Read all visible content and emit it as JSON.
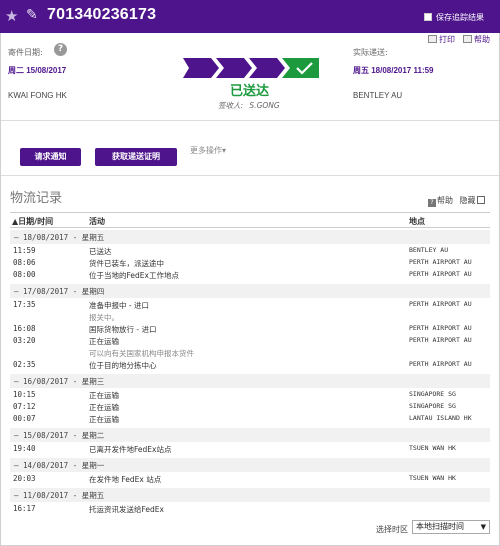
{
  "header": {
    "tracking_number": "701340236173",
    "save_results_label": "保存追踪结果"
  },
  "actions": {
    "print_label": "打印",
    "help_label": "帮助"
  },
  "shipment": {
    "ship_date_label": "寄件日期:",
    "ship_date": "周二 15/08/2017",
    "origin": "KWAI FONG HK",
    "delivered_label": "实际递送:",
    "delivered_date": "周五 18/08/2017 11:59",
    "destination": "BENTLEY AU",
    "status": "已送达",
    "signed_by_label": "签收人:",
    "signed_by": "S.GONG",
    "progress_steps": 4,
    "progress_completed": 4
  },
  "buttons": {
    "request_notify": "请求通知",
    "get_proof": "获取递送证明",
    "more_actions": "更多操作"
  },
  "history": {
    "title": "物流记录",
    "help": "帮助",
    "hide": "隐藏",
    "columns": {
      "datetime": "▲日期/时间",
      "activity": "活动",
      "location": "地点"
    },
    "groups": [
      {
        "date": "— 18/08/2017 - 星期五",
        "events": [
          {
            "time": "11:59",
            "activity": "已送达",
            "note": "",
            "location": "BENTLEY AU"
          },
          {
            "time": "08:06",
            "activity": "货件已装车，派送途中",
            "note": "",
            "location": "PERTH AIRPORT AU"
          },
          {
            "time": "08:00",
            "activity": "位于当地的FedEx工作地点",
            "note": "",
            "location": "PERTH AIRPORT AU"
          }
        ]
      },
      {
        "date": "— 17/08/2017 - 星期四",
        "events": [
          {
            "time": "17:35",
            "activity": "准备申报中 - 进口",
            "note": "报关中。",
            "location": "PERTH AIRPORT AU"
          },
          {
            "time": "16:08",
            "activity": "国际货物放行 - 进口",
            "note": "",
            "location": "PERTH AIRPORT AU"
          },
          {
            "time": "03:20",
            "activity": "正在运输",
            "note": "可以向有关国家机构申报本货件",
            "location": "PERTH AIRPORT AU"
          },
          {
            "time": "02:35",
            "activity": "位于目的地分拣中心",
            "note": "",
            "location": "PERTH AIRPORT AU"
          }
        ]
      },
      {
        "date": "— 16/08/2017 - 星期三",
        "events": [
          {
            "time": "10:15",
            "activity": "正在运输",
            "note": "",
            "location": "SINGAPORE SG"
          },
          {
            "time": "07:12",
            "activity": "正在运输",
            "note": "",
            "location": "SINGAPORE SG"
          },
          {
            "time": "00:07",
            "activity": "正在运输",
            "note": "",
            "location": "LANTAU ISLAND HK"
          }
        ]
      },
      {
        "date": "— 15/08/2017 - 星期二",
        "events": [
          {
            "time": "19:40",
            "activity": "已离开发件地FedEx站点",
            "note": "",
            "location": "TSUEN WAN HK"
          }
        ]
      },
      {
        "date": "— 14/08/2017 - 星期一",
        "events": [
          {
            "time": "20:03",
            "activity": "在发件地 FedEx 站点",
            "note": "",
            "location": "TSUEN WAN HK"
          }
        ]
      },
      {
        "date": "— 11/08/2017 - 星期五",
        "events": [
          {
            "time": "16:17",
            "activity": "托运资讯发送给FedEx",
            "note": "",
            "location": ""
          }
        ]
      }
    ]
  },
  "timezone": {
    "label": "选择时区",
    "selected": "本地扫描时间"
  },
  "colors": {
    "brand_purple": "#4d148c",
    "delivered_green": "#1d9a3e"
  },
  "icons": [
    "star-icon",
    "pencil-icon",
    "checkbox-icon",
    "print-icon",
    "help-icon",
    "question-icon",
    "check-icon",
    "dropdown-caret-icon"
  ]
}
